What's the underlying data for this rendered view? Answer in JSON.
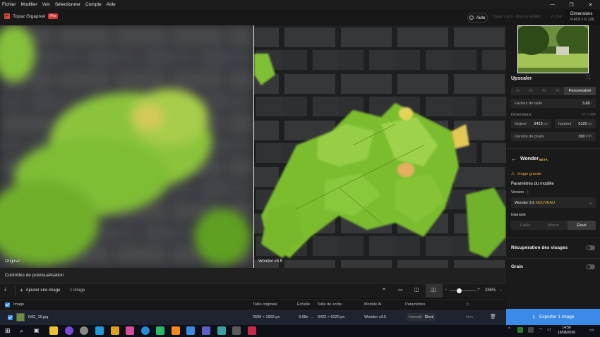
{
  "menu": [
    "Fichier",
    "Modifier",
    "Voir",
    "Sélectionner",
    "Compte",
    "Aide"
  ],
  "window_controls": [
    "—",
    "❐",
    "✕"
  ],
  "app": {
    "name": "Topaz Gigapixel",
    "badge": "Pro",
    "help_label": "Aide",
    "lab_text": "Topaz Labs - licence limitée",
    "version": "v1.0.4"
  },
  "dimensions_tip": {
    "title": "Dimensions",
    "value": "9 423 × 6 120"
  },
  "preview": {
    "left_label": "Original",
    "right_label": "Wonder v3.5"
  },
  "upscaler": {
    "title": "Upscaler",
    "scales": [
      "1x",
      "2x",
      "4x",
      "6x",
      "Personnalisé"
    ],
    "active_scale": "Personnalisé",
    "factor_label": "Facteur de taille",
    "factor_value": "3,68",
    "dimensions_label": "Dimensions",
    "dimensions_mp": "57,7 MP",
    "width_label": "largeur",
    "width_value": "9423",
    "width_unit": "px",
    "height_label": "hauteur",
    "height_value": "6120",
    "height_unit": "px",
    "density_label": "Densité de pixels",
    "density_value": "300",
    "density_unit": "PPI"
  },
  "model": {
    "back_icon": "arrow-left-icon",
    "name": "Wonder",
    "beta": "BETA",
    "warning": "Image grande",
    "params_title": "Paramètres du modèle",
    "version_label": "Version",
    "version_value": "Wonder 3.5",
    "version_tag": "NOUVEAU",
    "intensity_label": "Intensité",
    "intensity_options": [
      "Faible",
      "Moyen",
      "Élevé"
    ],
    "intensity_active": "Élevé"
  },
  "face_recovery": {
    "label": "Récupération des visages",
    "enabled": false
  },
  "grain": {
    "label": "Grain",
    "enabled": false
  },
  "export_label": "Exporter 1 image",
  "controls": {
    "title": "Contrôles de prévisualisation",
    "add_image": "Ajouter une image",
    "count": "1 image",
    "zoom": "286%",
    "zoom_level": 0.35
  },
  "table": {
    "headers": [
      "Image",
      "Taille originale",
      "Échelle",
      "Taille de sortie",
      "Modèle AI",
      "Paramètres"
    ],
    "rows": [
      {
        "name": "IMG_15.jpg",
        "original": "2559 × 1662 px",
        "scale": "3,68x",
        "output": "9423 × 6120 px",
        "model": "Wonder v3.5",
        "param_key": "Intensité",
        "param_value": "Élevé",
        "status": "Non"
      }
    ]
  },
  "taskbar": {
    "time": "14:56",
    "date": "19/08/2026"
  }
}
